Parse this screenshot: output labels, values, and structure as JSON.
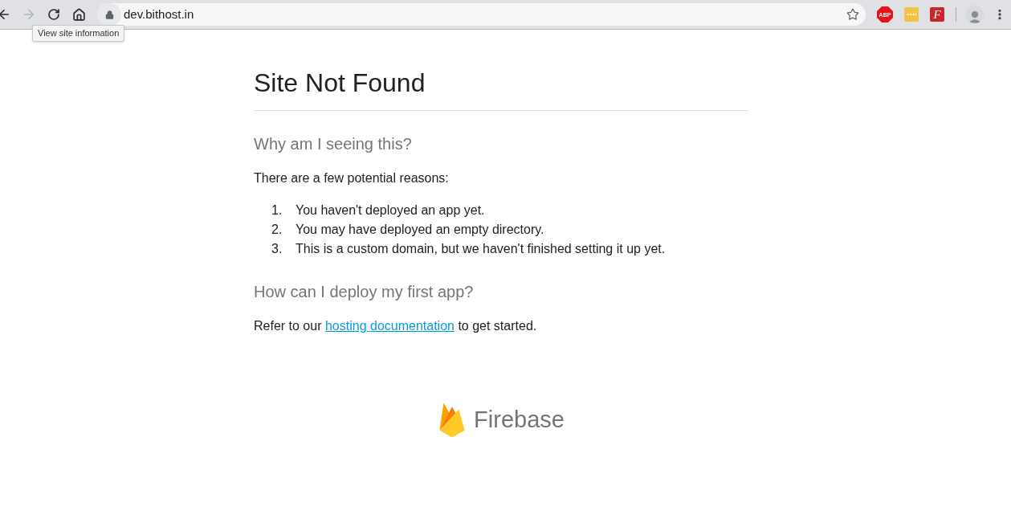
{
  "browser": {
    "back": {
      "disabled": false
    },
    "forward": {
      "disabled": true
    },
    "address": {
      "url": "dev.bithost.in",
      "tooltip": "View site information"
    },
    "extensions": [
      {
        "kind": "octagon",
        "label": "ABP"
      },
      {
        "kind": "dots"
      },
      {
        "kind": "letter",
        "label": "F"
      }
    ]
  },
  "page": {
    "title": "Site Not Found",
    "sections": [
      {
        "heading": "Why am I seeing this?",
        "intro": "There are a few potential reasons:",
        "items": [
          {
            "number": "1.",
            "text": "You haven't deployed an app yet."
          },
          {
            "number": "2.",
            "text": "You may have deployed an empty directory."
          },
          {
            "number": "3.",
            "text": "This is a custom domain, but we haven't finished setting it up yet."
          }
        ]
      },
      {
        "heading": "How can I deploy my first app?",
        "link_paragraph": {
          "before": "Refer to our",
          "link": "hosting documentation",
          "after": "to get started."
        }
      }
    ]
  },
  "footer": {
    "brand": "Firebase"
  }
}
